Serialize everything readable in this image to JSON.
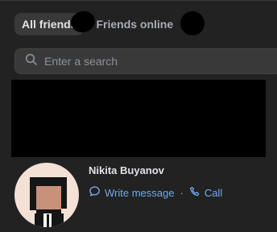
{
  "tabs": [
    {
      "label": "All friends",
      "active": true
    },
    {
      "label": "Friends online",
      "active": false
    }
  ],
  "search": {
    "placeholder": "Enter a search"
  },
  "friend": {
    "name": "Nikita Buyanov",
    "write_message": "Write message",
    "separator": "·",
    "call": "Call"
  },
  "colors": {
    "background": "#222222",
    "accent": "#71aaeb",
    "tab_active_bg": "#393939"
  },
  "icons": {
    "search": "search-icon",
    "message": "message-bubble-icon",
    "call": "phone-icon"
  }
}
